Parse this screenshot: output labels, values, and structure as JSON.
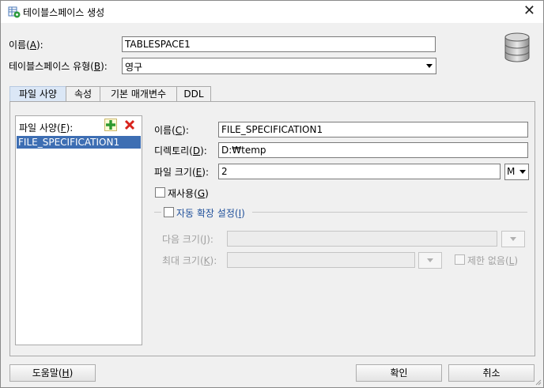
{
  "window": {
    "title": "테이블스페이스 생성"
  },
  "form": {
    "name_label": "이름(",
    "name_mnemonic": "A",
    "name_close": "):",
    "name_value": "TABLESPACE1",
    "type_label": "테이블스페이스 유형(",
    "type_mnemonic": "B",
    "type_close": "):",
    "type_value": "영구"
  },
  "tabs": [
    {
      "label": "파일 사양"
    },
    {
      "label": "속성"
    },
    {
      "label": "기본 매개변수"
    },
    {
      "label": "DDL"
    }
  ],
  "file_spec": {
    "list_label": "파일 사양(",
    "list_mnemonic": "F",
    "list_close": "):",
    "items": [
      "FILE_SPECIFICATION1"
    ],
    "name_label": "이름(",
    "name_mnemonic": "C",
    "name_close": "):",
    "name_value": "FILE_SPECIFICATION1",
    "dir_label": "디렉토리(",
    "dir_mnemonic": "D",
    "dir_close": "):",
    "dir_value": "D:₩temp",
    "size_label": "파일 크기(",
    "size_mnemonic": "E",
    "size_close": "):",
    "size_value": "2",
    "size_unit": "M",
    "reuse_label": "재사용(",
    "reuse_mnemonic": "G",
    "reuse_close": ")",
    "autoextend_label": "자동 확장 설정(",
    "autoextend_mnemonic": "I",
    "autoextend_close": ")",
    "next_size_label": "다음 크기(",
    "next_size_mnemonic": "J",
    "next_size_close": "):",
    "max_size_label": "최대 크기(",
    "max_size_mnemonic": "K",
    "max_size_close": "):",
    "unlimited_label": "제한 없음(",
    "unlimited_mnemonic": "L",
    "unlimited_close": ")"
  },
  "buttons": {
    "help_label": "도움말(",
    "help_mnemonic": "H",
    "help_close": ")",
    "ok_label": "확인",
    "cancel_label": "취소"
  },
  "colors": {
    "selection": "#3d6eb3",
    "active_tab": "#dbe7f6",
    "link_blue": "#1f4f9a"
  }
}
